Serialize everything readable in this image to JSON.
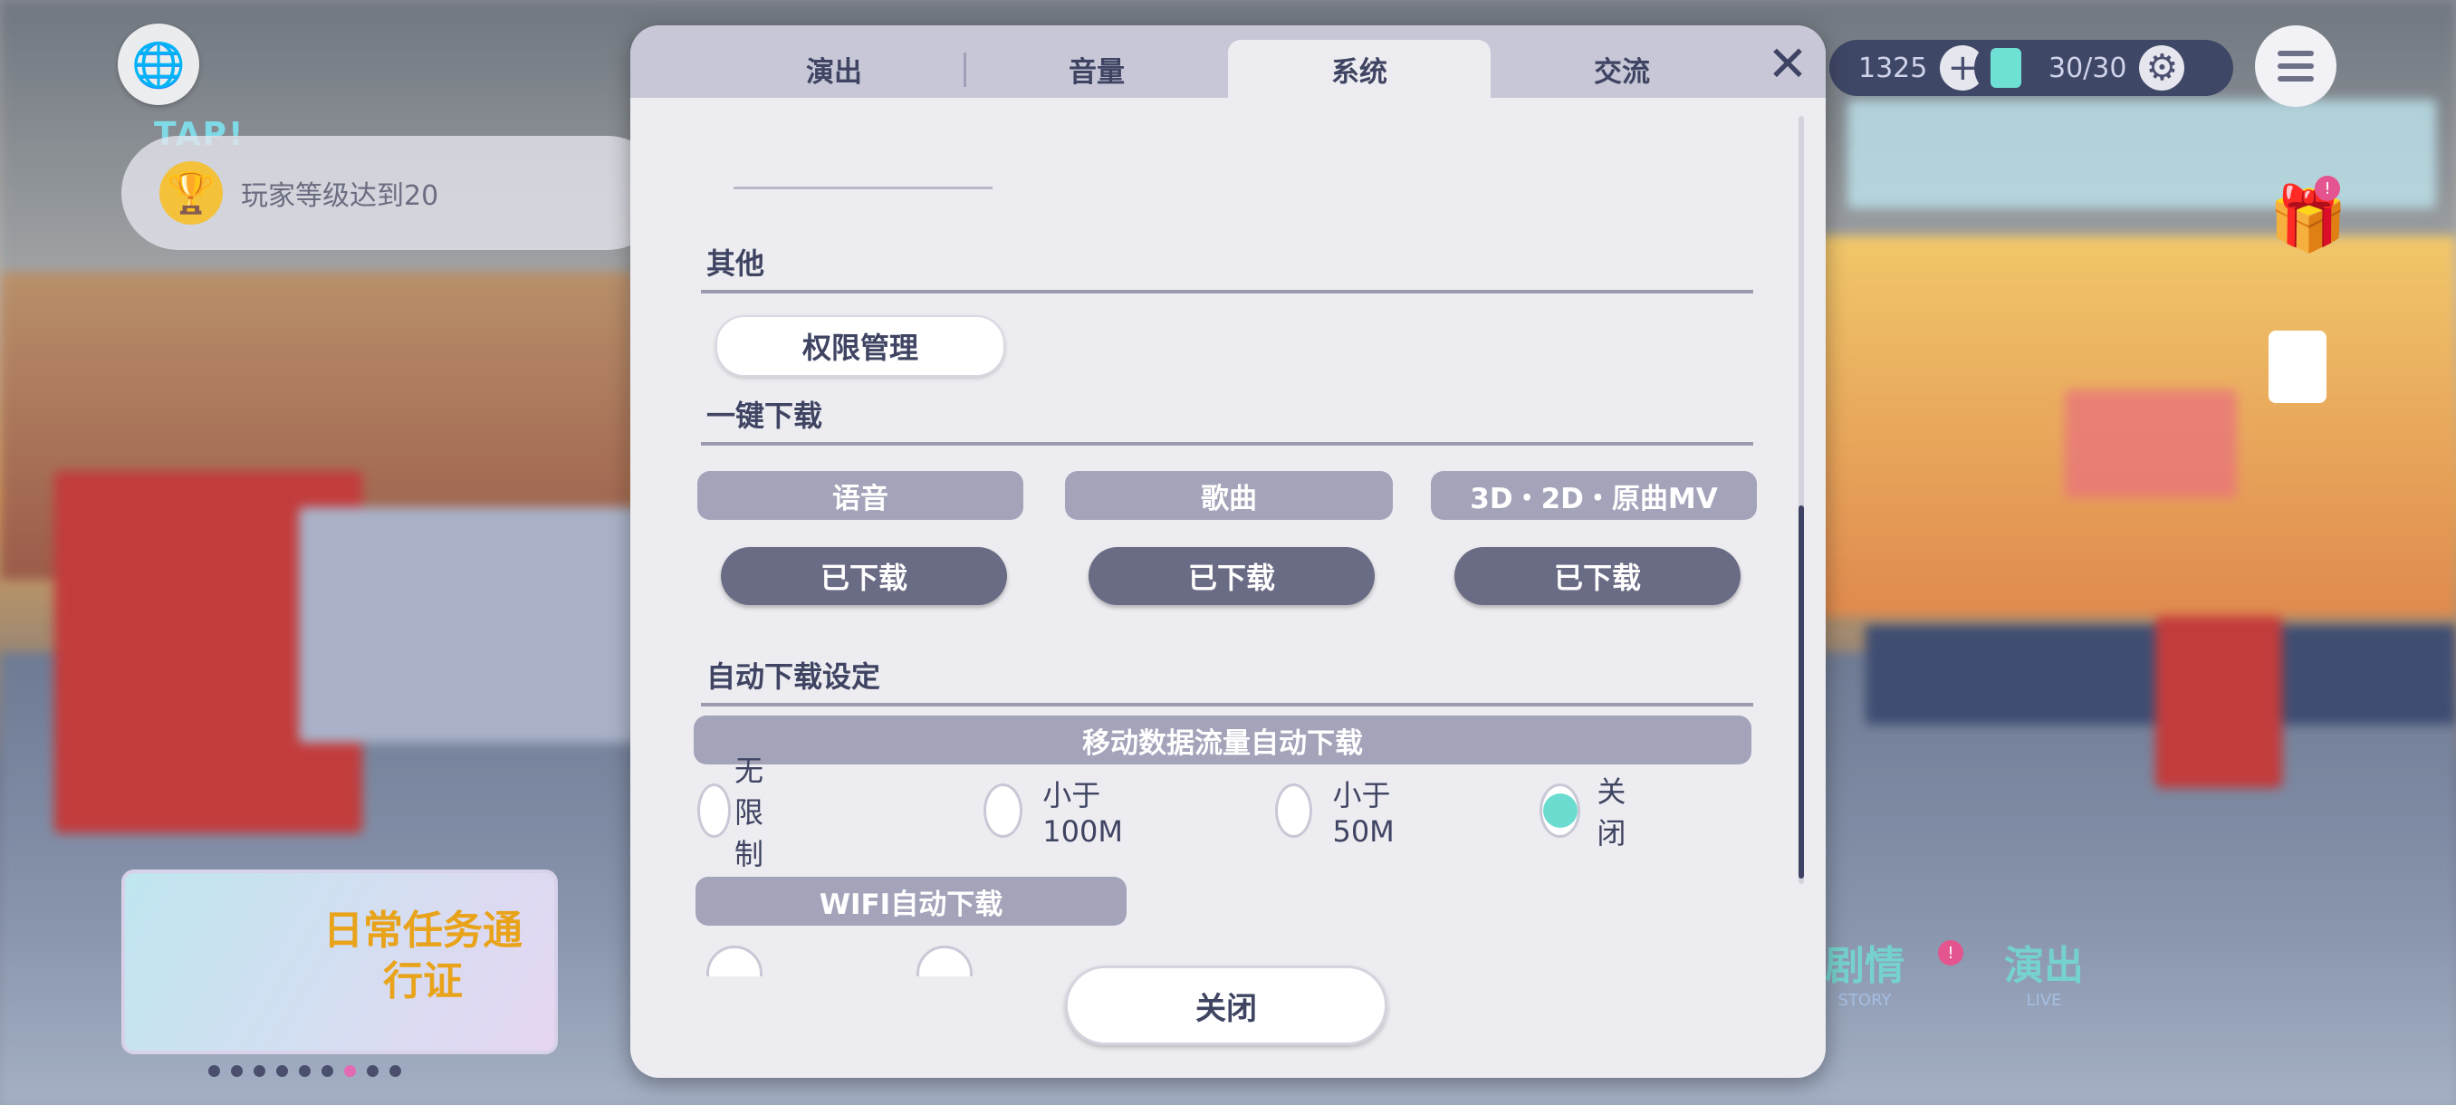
{
  "tabs": [
    {
      "label": "演出",
      "active": false
    },
    {
      "label": "音量",
      "active": false
    },
    {
      "label": "系统",
      "active": true
    },
    {
      "label": "交流",
      "active": false
    }
  ],
  "sections": {
    "other": {
      "title": "其他",
      "permission_button": "权限管理"
    },
    "one_click_download": {
      "title": "一键下载",
      "items": [
        {
          "header": "语音",
          "status": "已下载"
        },
        {
          "header": "歌曲",
          "status": "已下载"
        },
        {
          "header": "3D・2D・原曲MV",
          "status": "已下载"
        }
      ]
    },
    "auto_download": {
      "title": "自动下载设定",
      "mobile_header": "移动数据流量自动下载",
      "mobile_options": [
        {
          "label": "无限制",
          "selected": false
        },
        {
          "label": "小于100M",
          "selected": false
        },
        {
          "label": "小于50M",
          "selected": false
        },
        {
          "label": "关闭",
          "selected": true
        }
      ],
      "wifi_header": "WIFI自动下载"
    }
  },
  "footer": {
    "close_label": "关闭"
  },
  "scroll": {
    "position_fraction": 0.51,
    "visible_fraction": 0.49
  },
  "hud": {
    "mission_tag": "TAP!",
    "mission_text": "玩家等级达到20",
    "coins": "1325",
    "stamina": "30/30",
    "promo_title": "日常任务通行证",
    "bottom_nav": [
      {
        "label": "剧情",
        "sub": "STORY"
      },
      {
        "label": "演出",
        "sub": "LIVE"
      }
    ],
    "promo_dots": 9,
    "promo_active_dot": 7
  },
  "colors": {
    "accent_selected": "#6ddcd0",
    "dialog_bg": "#ededf1",
    "text_primary": "#3f4462",
    "download_button": "#6a6b84"
  },
  "icons": [
    "globe-icon",
    "trophy-icon",
    "close-icon",
    "plus-icon",
    "settings-icon",
    "menu-icon",
    "gift-icon",
    "clipboard-icon"
  ]
}
